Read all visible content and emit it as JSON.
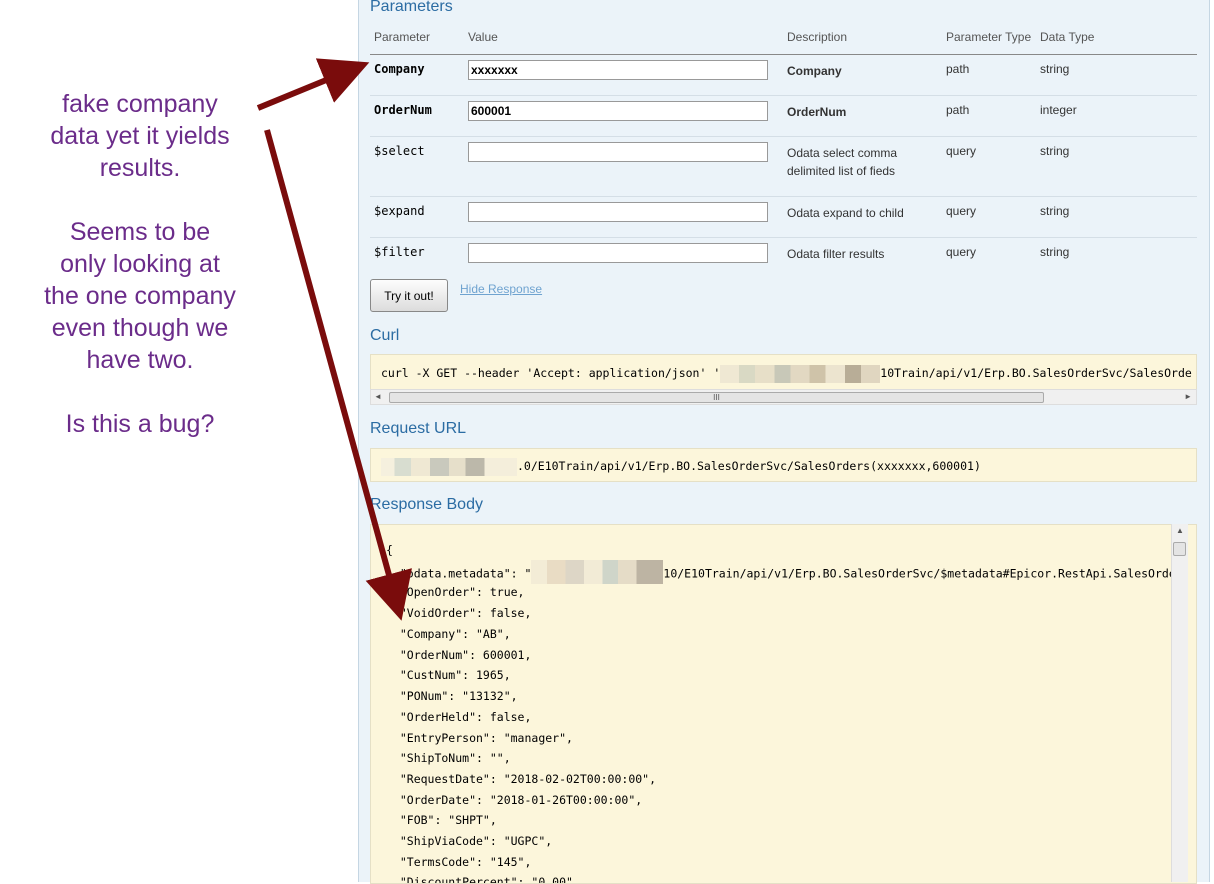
{
  "annotation": {
    "line1": "fake company",
    "line2": "data yet it yields",
    "line3": "results.",
    "line4": "Seems to be",
    "line5": "only looking at",
    "line6": "the one company",
    "line7": "even though we",
    "line8": "have two.",
    "line9": "Is this a bug?",
    "color": "#6b2c8a",
    "arrow_color": "#7a0c0c"
  },
  "parameters": {
    "title": "Parameters",
    "headers": {
      "parameter": "Parameter",
      "value": "Value",
      "description": "Description",
      "type": "Parameter Type",
      "data_type": "Data Type"
    },
    "rows": [
      {
        "name": "Company",
        "value": "xxxxxxx",
        "description": "Company",
        "type": "path",
        "data_type": "string"
      },
      {
        "name": "OrderNum",
        "value": "600001",
        "description": "OrderNum",
        "type": "path",
        "data_type": "integer"
      },
      {
        "name": "$select",
        "value": "",
        "description": "Odata select comma delimited list of fieds",
        "type": "query",
        "data_type": "string"
      },
      {
        "name": "$expand",
        "value": "",
        "description": "Odata expand to child",
        "type": "query",
        "data_type": "string"
      },
      {
        "name": "$filter",
        "value": "",
        "description": "Odata filter results",
        "type": "query",
        "data_type": "string"
      }
    ]
  },
  "actions": {
    "try_label": "Try it out!",
    "hide_label": "Hide Response"
  },
  "curl": {
    "title": "Curl",
    "prefix": "curl -X GET --header 'Accept: application/json' '",
    "suffix": "10Train/api/v1/Erp.BO.SalesOrderSvc/SalesOrde",
    "scroll_mark": "III"
  },
  "request_url": {
    "title": "Request URL",
    "suffix": ".0/E10Train/api/v1/Erp.BO.SalesOrderSvc/SalesOrders(xxxxxxx,600001)"
  },
  "response": {
    "title": "Response Body",
    "lines": [
      "{",
      "  \"odata.metadata\": \"",
      "  \"OpenOrder\": true,",
      "  \"VoidOrder\": false,",
      "  \"Company\": \"AB\",",
      "  \"OrderNum\": 600001,",
      "  \"CustNum\": 1965,",
      "  \"PONum\": \"13132\",",
      "  \"OrderHeld\": false,",
      "  \"EntryPerson\": \"manager\",",
      "  \"ShipToNum\": \"\",",
      "  \"RequestDate\": \"2018-02-02T00:00:00\",",
      "  \"OrderDate\": \"2018-01-26T00:00:00\",",
      "  \"FOB\": \"SHPT\",",
      "  \"ShipViaCode\": \"UGPC\",",
      "  \"TermsCode\": \"145\",",
      "  \"DiscountPercent\": \"0.00\","
    ],
    "metadata_suffix": "10/E10Train/api/v1/Erp.BO.SalesOrderSvc/$metadata#Epicor.RestApi.SalesOrde"
  },
  "colors": {
    "panel_bg": "#ebf3f9",
    "title_blue": "#2b6ca3",
    "code_bg": "#fcf6db",
    "link": "#6fa3d0"
  }
}
